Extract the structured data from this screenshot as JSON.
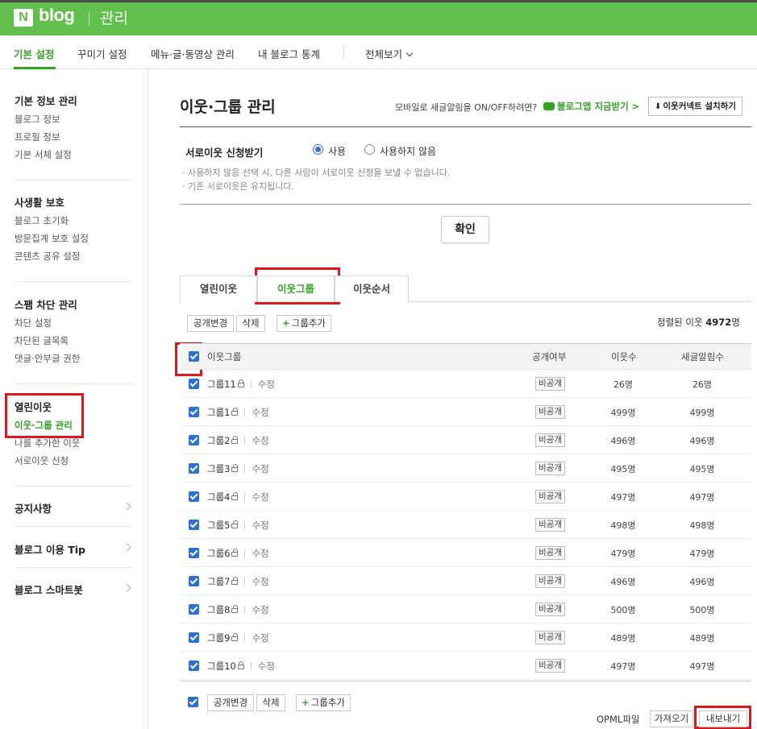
{
  "header": {
    "logo_n": "N",
    "logo_blog": "blog",
    "admin_label": "관리"
  },
  "menu": {
    "items": [
      "기본 설정",
      "꾸미기 설정",
      "메뉴·글·동영상 관리",
      "내 블로그 통계"
    ],
    "all_view": "전체보기"
  },
  "sidebar": {
    "sections": [
      {
        "title": "기본 정보 관리",
        "items": [
          "블로그 정보",
          "프로필 정보",
          "기본 서체 설정"
        ]
      },
      {
        "title": "사생활 보호",
        "items": [
          "블로그 초기화",
          "방문집계 보호 설정",
          "콘텐츠 공유 설정"
        ]
      },
      {
        "title": "스팸 차단 관리",
        "items": [
          "차단 설정",
          "차단된 글목록",
          "댓글·안부글 권한"
        ]
      },
      {
        "title": "열린이웃",
        "items": [
          "이웃·그룹 관리",
          "나를 추가한 이웃",
          "서로이웃 신청"
        ]
      }
    ],
    "links": [
      "공지사항",
      "블로그 이용 Tip",
      "블로그 스마트봇"
    ]
  },
  "main": {
    "title": "이웃·그룹 관리",
    "mobile_note": "모바일로 새글알림을 ON/OFF하려면?",
    "app_link": "블로그앱 지금받기 >",
    "install_button": "이웃커넥트 설치하기",
    "option_label": "서로이웃 신청받기",
    "radio_use": "사용",
    "radio_not_use": "사용하지 않음",
    "hint1": "· 사용하지 않음 선택 시, 다른 사람이 서로이웃 신청을 보낼 수 없습니다.",
    "hint2": "· 기존 서로이웃은 유지됩니다.",
    "confirm": "확인",
    "tabs": [
      "열린이웃",
      "이웃그룹",
      "이웃순서"
    ],
    "toolbar": {
      "visibility": "공개변경",
      "delete": "삭제",
      "add_group": "그룹추가"
    },
    "total_prefix": "정렬된 이웃",
    "total_count": "4972",
    "total_unit": "명",
    "columns": {
      "group": "이웃그룹",
      "visibility": "공개여부",
      "neighbors": "이웃수",
      "alerts": "새글알림수"
    },
    "edit_label": "수정",
    "private_label": "비공개",
    "rows": [
      {
        "name": "그룹11",
        "count": "26명",
        "alerts": "26명"
      },
      {
        "name": "그룹1",
        "count": "499명",
        "alerts": "499명"
      },
      {
        "name": "그룹2",
        "count": "496명",
        "alerts": "496명"
      },
      {
        "name": "그룹3",
        "count": "495명",
        "alerts": "495명"
      },
      {
        "name": "그룹4",
        "count": "497명",
        "alerts": "497명"
      },
      {
        "name": "그룹5",
        "count": "498명",
        "alerts": "498명"
      },
      {
        "name": "그룹6",
        "count": "479명",
        "alerts": "479명"
      },
      {
        "name": "그룹7",
        "count": "496명",
        "alerts": "496명"
      },
      {
        "name": "그룹8",
        "count": "500명",
        "alerts": "500명"
      },
      {
        "name": "그룹9",
        "count": "489명",
        "alerts": "489명"
      },
      {
        "name": "그룹10",
        "count": "497명",
        "alerts": "497명"
      }
    ],
    "opml_label": "OPML파일",
    "import": "가져오기",
    "export": "내보내기"
  },
  "colors": {
    "brand_green": "#61c04b",
    "accent_green": "#34a224",
    "highlight_red": "#e0161e",
    "checkbox_blue": "#2b6fd8"
  }
}
